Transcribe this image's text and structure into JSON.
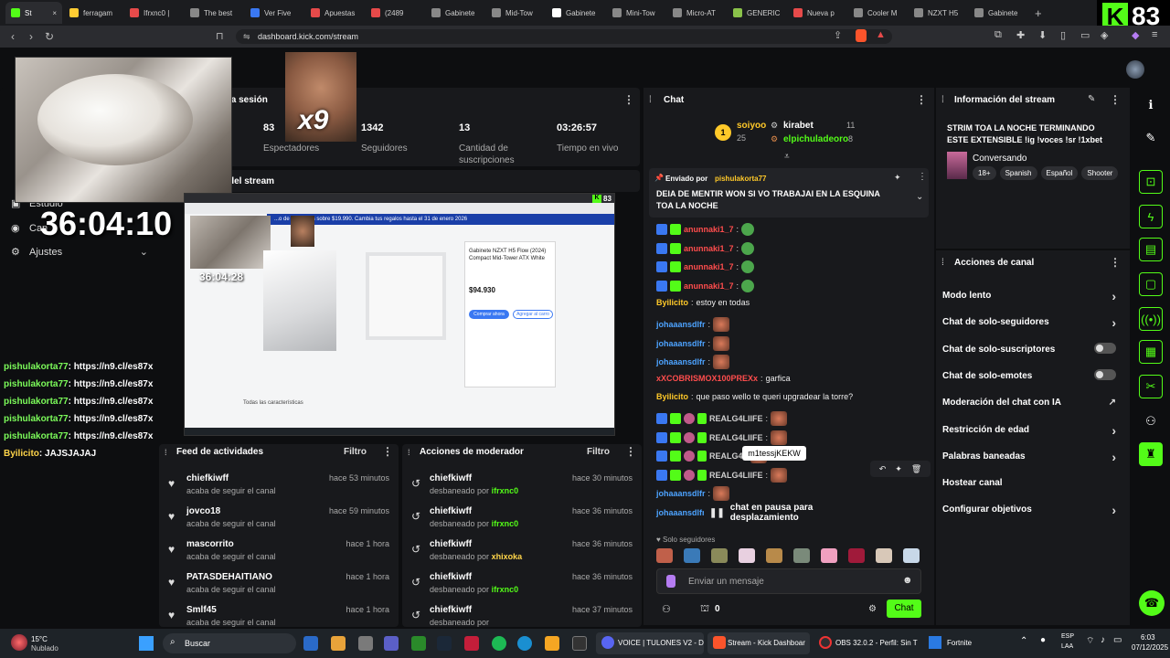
{
  "browser": {
    "tabs": [
      {
        "label": "St",
        "color": "#53fc18",
        "active": true
      },
      {
        "label": "ferragam",
        "color": "#ffcc33"
      },
      {
        "label": "Ifrxnc0 |",
        "color": "#e64a4a"
      },
      {
        "label": "The best",
        "color": "#888888"
      },
      {
        "label": "Ver Five",
        "color": "#3a78f2"
      },
      {
        "label": "Apuestas",
        "color": "#e64a4a"
      },
      {
        "label": "(2489",
        "color": "#e64a4a"
      },
      {
        "label": "Gabinete",
        "color": "#888888"
      },
      {
        "label": "Mid-Tow",
        "color": "#888888"
      },
      {
        "label": "Gabinete",
        "color": "#ffffff"
      },
      {
        "label": "Mini-Tow",
        "color": "#888888"
      },
      {
        "label": "Micro-AT",
        "color": "#888888"
      },
      {
        "label": "GENERIC",
        "color": "#8ac24a"
      },
      {
        "label": "Nueva p",
        "color": "#e64a4a"
      },
      {
        "label": "Cooler M",
        "color": "#888888"
      },
      {
        "label": "NZXT H5",
        "color": "#888888"
      },
      {
        "label": "Gabinete",
        "color": "#888888"
      }
    ],
    "new_tab": "+",
    "url": "dashboard.kick.com/stream",
    "kick_count": "83"
  },
  "overlay": {
    "meme_text": "x9",
    "timer": "36:04:10",
    "session_title_partial": "la sesión",
    "stream_title_partial": "del stream",
    "side_items": [
      "Estudio",
      "Can",
      "Ajustes"
    ],
    "chat_lines": [
      {
        "user": "pishulakorta77",
        "text": ": https://n9.cl/es87x"
      },
      {
        "user": "pishulakorta77",
        "text": ": https://n9.cl/es87x"
      },
      {
        "user": "pishulakorta77",
        "text": ": https://n9.cl/es87x"
      },
      {
        "user": "pishulakorta77",
        "text": ": https://n9.cl/es87x"
      },
      {
        "user": "pishulakorta77",
        "text": ": https://n9.cl/es87x"
      },
      {
        "user": "Byilicito",
        "text": ": JAJSJAJAJ"
      }
    ]
  },
  "stats": [
    {
      "value": "83",
      "label": "Espectadores"
    },
    {
      "value": "1342",
      "label": "Seguidores"
    },
    {
      "value": "13",
      "label": "Cantidad de suscripciones"
    },
    {
      "value": "03:26:57",
      "label": "Tiempo en vivo"
    }
  ],
  "preview": {
    "banner": "...o de productos sobre $19.990.  Cambia tus regalos hasta el 31 de enero 2026",
    "product_title": "Gabinete NZXT H5 Flow (2024) Compact Mid-Tower ATX White",
    "price": "$94.930",
    "buy": "Comprar ahora",
    "cart": "Agregar al carro",
    "timer": "36:04:28",
    "features": "Todas las características",
    "kick_count": "83"
  },
  "feed": {
    "title": "Feed de actividades",
    "filter": "Filtro",
    "items": [
      {
        "name": "chiefkiwff",
        "sub": "acaba de seguir el canal",
        "time": "hace 53 minutos"
      },
      {
        "name": "jovco18",
        "sub": "acaba de seguir el canal",
        "time": "hace 59 minutos"
      },
      {
        "name": "mascorrito",
        "sub": "acaba de seguir el canal",
        "time": "hace 1 hora"
      },
      {
        "name": "PATASDEHAITIANO",
        "sub": "acaba de seguir el canal",
        "time": "hace 1 hora"
      },
      {
        "name": "Smlf45",
        "sub": "acaba de seguir el canal",
        "time": "hace 1 hora"
      }
    ]
  },
  "mod": {
    "title": "Acciones de moderador",
    "filter": "Filtro",
    "items": [
      {
        "name": "chiefkiwff",
        "action": "desbaneado por",
        "by": "ifrxnc0",
        "time": "hace 30 minutos"
      },
      {
        "name": "chiefkiwff",
        "action": "desbaneado por",
        "by": "ifrxnc0",
        "time": "hace 36 minutos"
      },
      {
        "name": "chiefkiwff",
        "action": "desbaneado por",
        "by": "xhixoka",
        "time": "hace 36 minutos"
      },
      {
        "name": "chiefkiwff",
        "action": "desbaneado por",
        "by": "ifrxnc0",
        "time": "hace 36 minutos"
      },
      {
        "name": "chiefkiwff",
        "action": "desbaneado por",
        "by": "",
        "time": "hace 37 minutos"
      }
    ]
  },
  "chat": {
    "title": "Chat",
    "top": [
      {
        "rank": "1",
        "name": "soiyoo",
        "value": "25"
      },
      {
        "name": "kirabet",
        "value": "11"
      },
      {
        "name": "elpichuladeoro",
        "value": "8"
      }
    ],
    "pinned_by_label": "Enviado por",
    "pinned_by": "pishulakorta77",
    "pinned_text": "DEIA DE MENTIR WON SI VO TRABAJAI EN LA ESQUINA TOA LA NOCHE",
    "messages": [
      {
        "user": "anunnaki1_7",
        "kind": "red-emote"
      },
      {
        "user": "anunnaki1_7",
        "kind": "red-emote"
      },
      {
        "user": "anunnaki1_7",
        "kind": "red-emote"
      },
      {
        "user": "anunnaki1_7",
        "kind": "red-emote"
      },
      {
        "user": "Byilicito",
        "text": "estoy en todas",
        "kind": "yellow"
      },
      {
        "user": "johaaansdlfr",
        "kind": "blue-emote"
      },
      {
        "user": "johaaansdlfr",
        "kind": "blue-emote"
      },
      {
        "user": "johaaansdlfr",
        "kind": "blue-emote"
      },
      {
        "user": "xXCOBRISMOX100PREXx",
        "text": "garfica",
        "kind": "red"
      },
      {
        "user": "Byilicito",
        "text": "que paso wello te queri upgradear la torre?",
        "kind": "yellow"
      },
      {
        "user": "REALG4LIIFE",
        "kind": "green-emote"
      },
      {
        "user": "REALG4LIIFE",
        "kind": "green-emote"
      },
      {
        "user": "REALG4",
        "kind": "green-emote"
      },
      {
        "user": "REALG4LIIFE",
        "kind": "green-emote"
      },
      {
        "user": "johaaansdlfr",
        "kind": "blue-emote"
      },
      {
        "user": "johaaansdlfr",
        "kind": "blue-emote"
      }
    ],
    "tooltip": "m1tessjKEKW",
    "paused": "chat en pausa para desplazamiento",
    "followers_only": "Solo seguidores",
    "input_placeholder": "Enviar un mensaje",
    "points": "0",
    "send": "Chat"
  },
  "info": {
    "title": "Información del stream",
    "stream_title": "STRIM TOA LA NOCHE TERMINANDO ESTE EXTENSIBLE !ig !voces !sr !1xbet",
    "category": "Conversando",
    "tags": [
      "18+",
      "Spanish",
      "Español",
      "Shooter"
    ]
  },
  "actions": {
    "title": "Acciones de canal",
    "items": [
      {
        "label": "Modo lento",
        "control": "chevron"
      },
      {
        "label": "Chat de solo-seguidores",
        "control": "chevron"
      },
      {
        "label": "Chat de solo-suscriptores",
        "control": "toggle"
      },
      {
        "label": "Chat de solo-emotes",
        "control": "toggle"
      },
      {
        "label": "Moderación del chat con IA",
        "control": "link"
      },
      {
        "label": "Restricción de edad",
        "control": "chevron"
      },
      {
        "label": "Palabras baneadas",
        "control": "chevron"
      },
      {
        "label": "Hostear canal",
        "control": "none"
      },
      {
        "label": "Configurar objetivos",
        "control": "chevron"
      }
    ]
  },
  "taskbar": {
    "weather_temp": "15°C",
    "weather_desc": "Nublado",
    "search": "Buscar",
    "discord": "VOICE | TULONES V2 - D",
    "brave": "Stream - Kick Dashboar",
    "obs": "OBS 32.0.2 - Perfil: Sin T",
    "fortnite": "Fortnite",
    "lang": "ESP",
    "lang2": "LAA",
    "time": "6:03",
    "date": "07/12/2025"
  }
}
